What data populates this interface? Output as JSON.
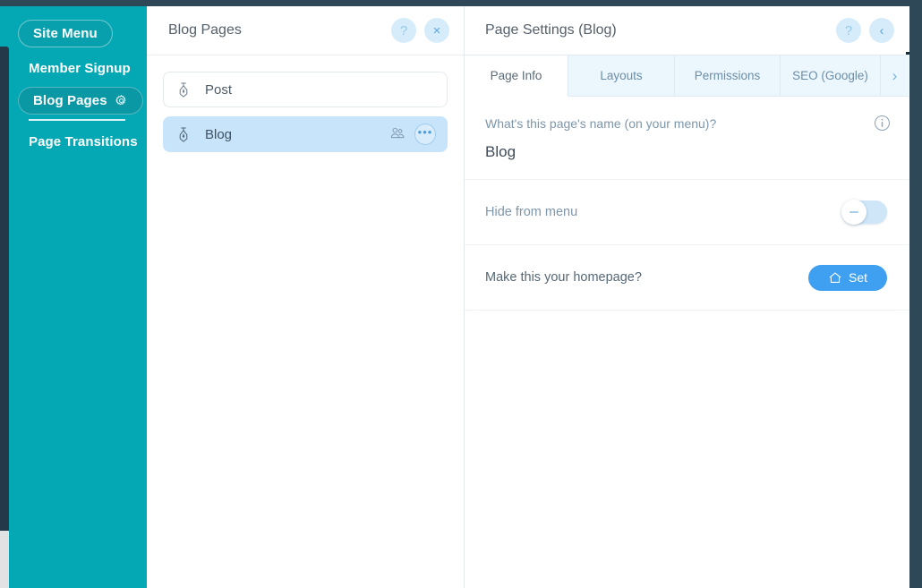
{
  "sidebar": {
    "items": [
      {
        "label": "Site Menu",
        "style": "pill"
      },
      {
        "label": "Member Signup",
        "style": "plain"
      },
      {
        "label": "Blog Pages",
        "style": "pill-strong",
        "icon": "gear-icon"
      },
      {
        "label": "Page Transitions",
        "style": "plain"
      }
    ],
    "background_color": "#04a8b4"
  },
  "pages_panel": {
    "title": "Blog Pages",
    "help_label": "?",
    "close_label": "×",
    "items": [
      {
        "label": "Post",
        "icon": "pen-nib-icon",
        "selected": false
      },
      {
        "label": "Blog",
        "icon": "pen-nib-icon",
        "selected": true,
        "members_icon": "members-icon",
        "more_label": "•••"
      }
    ]
  },
  "settings_panel": {
    "title": "Page Settings (Blog)",
    "help_label": "?",
    "back_label": "‹",
    "tabs": [
      {
        "label": "Page Info",
        "active": true
      },
      {
        "label": "Layouts",
        "active": false
      },
      {
        "label": "Permissions",
        "active": false
      },
      {
        "label": "SEO (Google)",
        "active": false
      }
    ],
    "tabs_next_label": "›",
    "page_name": {
      "question": "What's this page's name (on your menu)?",
      "value": "Blog",
      "info_icon": "info-icon"
    },
    "hide_from_menu": {
      "label": "Hide from menu",
      "toggle_state": "off"
    },
    "homepage": {
      "label": "Make this your homepage?",
      "button_label": "Set",
      "button_icon": "home-icon",
      "button_color": "#3f9ff0"
    }
  }
}
